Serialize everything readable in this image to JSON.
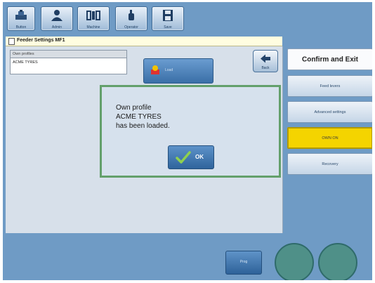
{
  "toolbar": {
    "buttons": [
      {
        "label": "Button",
        "icon": "stack-icon"
      },
      {
        "label": "Admin",
        "icon": "user-icon"
      },
      {
        "label": "Machine",
        "icon": "machine-icon"
      },
      {
        "label": "Operator",
        "icon": "hand-icon"
      },
      {
        "label": "Save",
        "icon": "floppy-disk-icon"
      }
    ]
  },
  "window": {
    "title": "Feeder Settings MF1"
  },
  "profiles": {
    "header": "Own profiles",
    "items": [
      "ACME TYRES"
    ]
  },
  "load_button": {
    "label": "Load"
  },
  "back_button": {
    "label": "Back"
  },
  "dialog": {
    "message": "Own profile\nACME TYRES\nhas been loaded.",
    "ok_label": "OK"
  },
  "side_menu": {
    "confirm_label": "Confirm and Exit",
    "items": [
      "Feed levers",
      "Advanced settings",
      "OWN ON",
      "Recovery"
    ]
  },
  "bottom": {
    "button_label": "Prog"
  },
  "colors": {
    "screen_background": "#6f9bc5",
    "dialog_border": "#63a06b",
    "active_item": "#f4d400"
  }
}
